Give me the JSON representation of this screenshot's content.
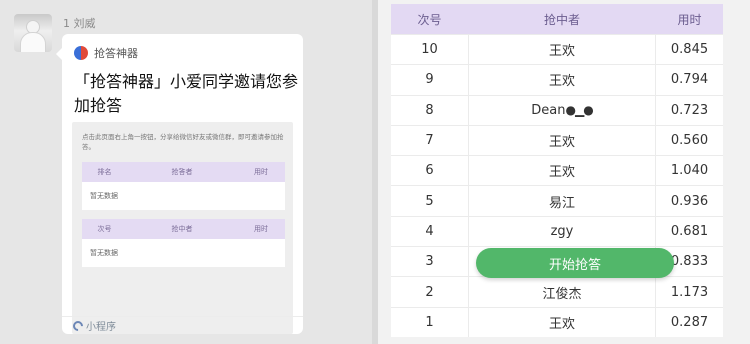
{
  "chat": {
    "sender": "1 刘威",
    "card": {
      "app_name": "抢答神器",
      "title": "「抢答神器」小爱同学邀请您参加抢答",
      "hint": "点击此页面右上角一按钮，分享给微信好友或微信群，即可邀请参加抢答。",
      "tables": [
        {
          "headers": [
            "排名",
            "抢答者",
            "用时"
          ],
          "empty": "暂无数据"
        },
        {
          "headers": [
            "次号",
            "抢中者",
            "用时"
          ],
          "empty": "暂无数据"
        }
      ],
      "footer": "小程序"
    }
  },
  "ranking": {
    "headers": {
      "no": "次号",
      "name": "抢中者",
      "time": "用时"
    },
    "rows": [
      {
        "no": "10",
        "name": "王欢",
        "time": "0.845"
      },
      {
        "no": "9",
        "name": "王欢",
        "time": "0.794"
      },
      {
        "no": "8",
        "name": "Dean",
        "time": "0.723"
      },
      {
        "no": "7",
        "name": "王欢",
        "time": "0.560"
      },
      {
        "no": "6",
        "name": "王欢",
        "time": "1.040"
      },
      {
        "no": "5",
        "name": "易江",
        "time": "0.936"
      },
      {
        "no": "4",
        "name": "zgy",
        "time": "0.681"
      },
      {
        "no": "3",
        "name": "",
        "time": "0.833"
      },
      {
        "no": "2",
        "name": "江俊杰",
        "time": "1.173"
      },
      {
        "no": "1",
        "name": "王欢",
        "time": "0.287"
      }
    ],
    "start_button": "开始抢答",
    "row8_emoji": "●▁●"
  },
  "colors": {
    "table_header": "#e3d9f3",
    "start_button": "#52b76a"
  }
}
